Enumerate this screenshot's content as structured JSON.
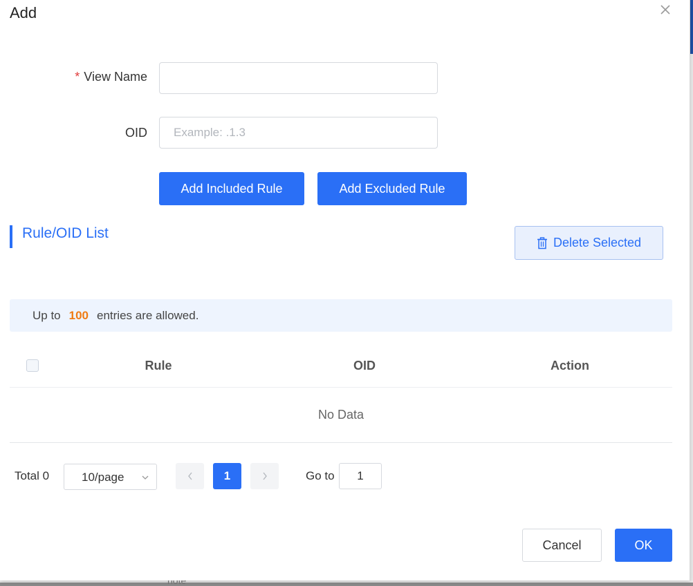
{
  "dialog": {
    "title": "Add",
    "background_text": "note"
  },
  "form": {
    "view_name": {
      "required_mark": "*",
      "label": "View Name",
      "value": "",
      "placeholder": ""
    },
    "oid": {
      "label": "OID",
      "value": "",
      "placeholder": "Example: .1.3"
    },
    "add_included_label": "Add Included Rule",
    "add_excluded_label": "Add Excluded Rule"
  },
  "section": {
    "title": "Rule/OID List",
    "delete_label": "Delete Selected"
  },
  "notice": {
    "prefix": "Up to",
    "count": "100",
    "suffix": "entries are allowed."
  },
  "table": {
    "columns": [
      "Rule",
      "OID",
      "Action"
    ],
    "rows": [],
    "empty_text": "No Data"
  },
  "pagination": {
    "total_label": "Total 0",
    "page_size": "10/page",
    "current_page": "1",
    "goto_label": "Go to",
    "goto_value": "1"
  },
  "footer": {
    "cancel_label": "Cancel",
    "ok_label": "OK"
  },
  "colors": {
    "primary": "#2a6ff6",
    "required": "#e03c3c",
    "highlight": "#f07b12",
    "notice_bg": "#eef4fe"
  },
  "icons": {
    "close": "close-icon",
    "trash": "trash-icon",
    "chevron_left": "chevron-left-icon",
    "chevron_right": "chevron-right-icon",
    "chevron_down": "chevron-down-icon"
  }
}
